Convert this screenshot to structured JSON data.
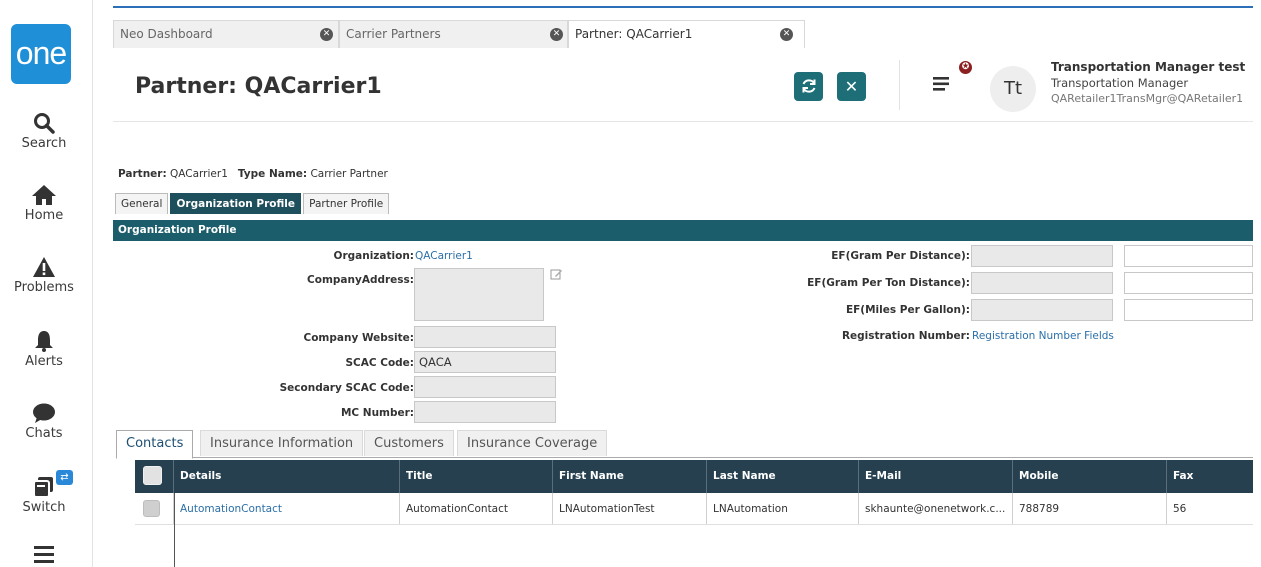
{
  "nav": {
    "logo": "one",
    "items": [
      {
        "label": "Search",
        "icon": "search-icon"
      },
      {
        "label": "Home",
        "icon": "home-icon"
      },
      {
        "label": "Problems",
        "icon": "warning-icon"
      },
      {
        "label": "Alerts",
        "icon": "bell-icon"
      },
      {
        "label": "Chats",
        "icon": "chat-icon"
      },
      {
        "label": "Switch",
        "icon": "switch-icon"
      }
    ]
  },
  "window_tabs": [
    {
      "label": "Neo Dashboard"
    },
    {
      "label": "Carrier Partners"
    },
    {
      "label": "Partner: QACarrier1"
    }
  ],
  "header": {
    "title": "Partner: QACarrier1",
    "refresh_icon": "refresh-icon",
    "close_icon": "close-icon",
    "avatar_initials": "Tt",
    "user_name": "Transportation Manager test",
    "user_role": "Transportation Manager",
    "user_email": "QARetailer1TransMgr@QARetailer1"
  },
  "partner_line": {
    "partner_label": "Partner:",
    "partner_value": "QACarrier1",
    "type_label": "Type Name:",
    "type_value": "Carrier Partner"
  },
  "inner_tabs": [
    "General",
    "Organization Profile",
    "Partner Profile"
  ],
  "section_title": "Organization Profile",
  "form": {
    "organization_label": "Organization:",
    "organization_value": "QACarrier1",
    "company_address_label": "CompanyAddress:",
    "company_website_label": "Company Website:",
    "scac_label": "SCAC Code:",
    "scac_value": "QACA",
    "secondary_scac_label": "Secondary SCAC Code:",
    "mc_number_label": "MC Number:",
    "ef_gram_distance_label": "EF(Gram Per Distance):",
    "ef_gram_ton_label": "EF(Gram Per Ton Distance):",
    "ef_miles_gallon_label": "EF(Miles Per Gallon):",
    "registration_label": "Registration Number:",
    "registration_value": "Registration Number Fields"
  },
  "bottom_tabs": [
    "Contacts",
    "Insurance Information",
    "Customers",
    "Insurance Coverage"
  ],
  "table": {
    "columns": [
      "Details",
      "Title",
      "First Name",
      "Last Name",
      "E-Mail",
      "Mobile",
      "Fax"
    ],
    "rows": [
      [
        "AutomationContact",
        "AutomationContact",
        "LNAutomationTest",
        "LNAutomation",
        "skhaunte@onenetwork.c...",
        "788789",
        "56"
      ]
    ]
  }
}
